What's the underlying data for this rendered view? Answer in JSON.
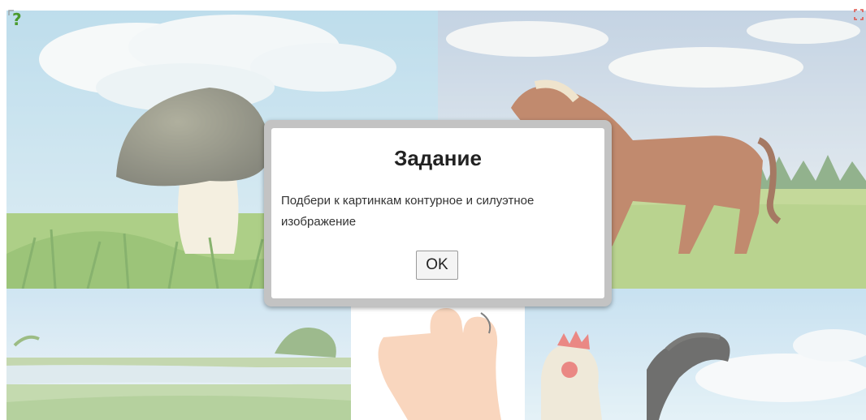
{
  "game": {
    "help_icon": "help-question-icon",
    "fullscreen_icon": "fullscreen-icon",
    "tiles": [
      {
        "name": "mushroom-picture"
      },
      {
        "name": "horse-picture"
      },
      {
        "name": "river-landscape-picture"
      },
      {
        "name": "hand-picture"
      },
      {
        "name": "rooster-picture"
      }
    ]
  },
  "dialog": {
    "title": "Задание",
    "message": "Подбери к картинкам контурное и силуэтное изображение",
    "ok_label": "OK"
  },
  "colors": {
    "sky": "#b4d6e6",
    "grass": "#8fc25c",
    "dialog_frame": "#c3c3c3",
    "dialog_bg": "#ffffff"
  }
}
